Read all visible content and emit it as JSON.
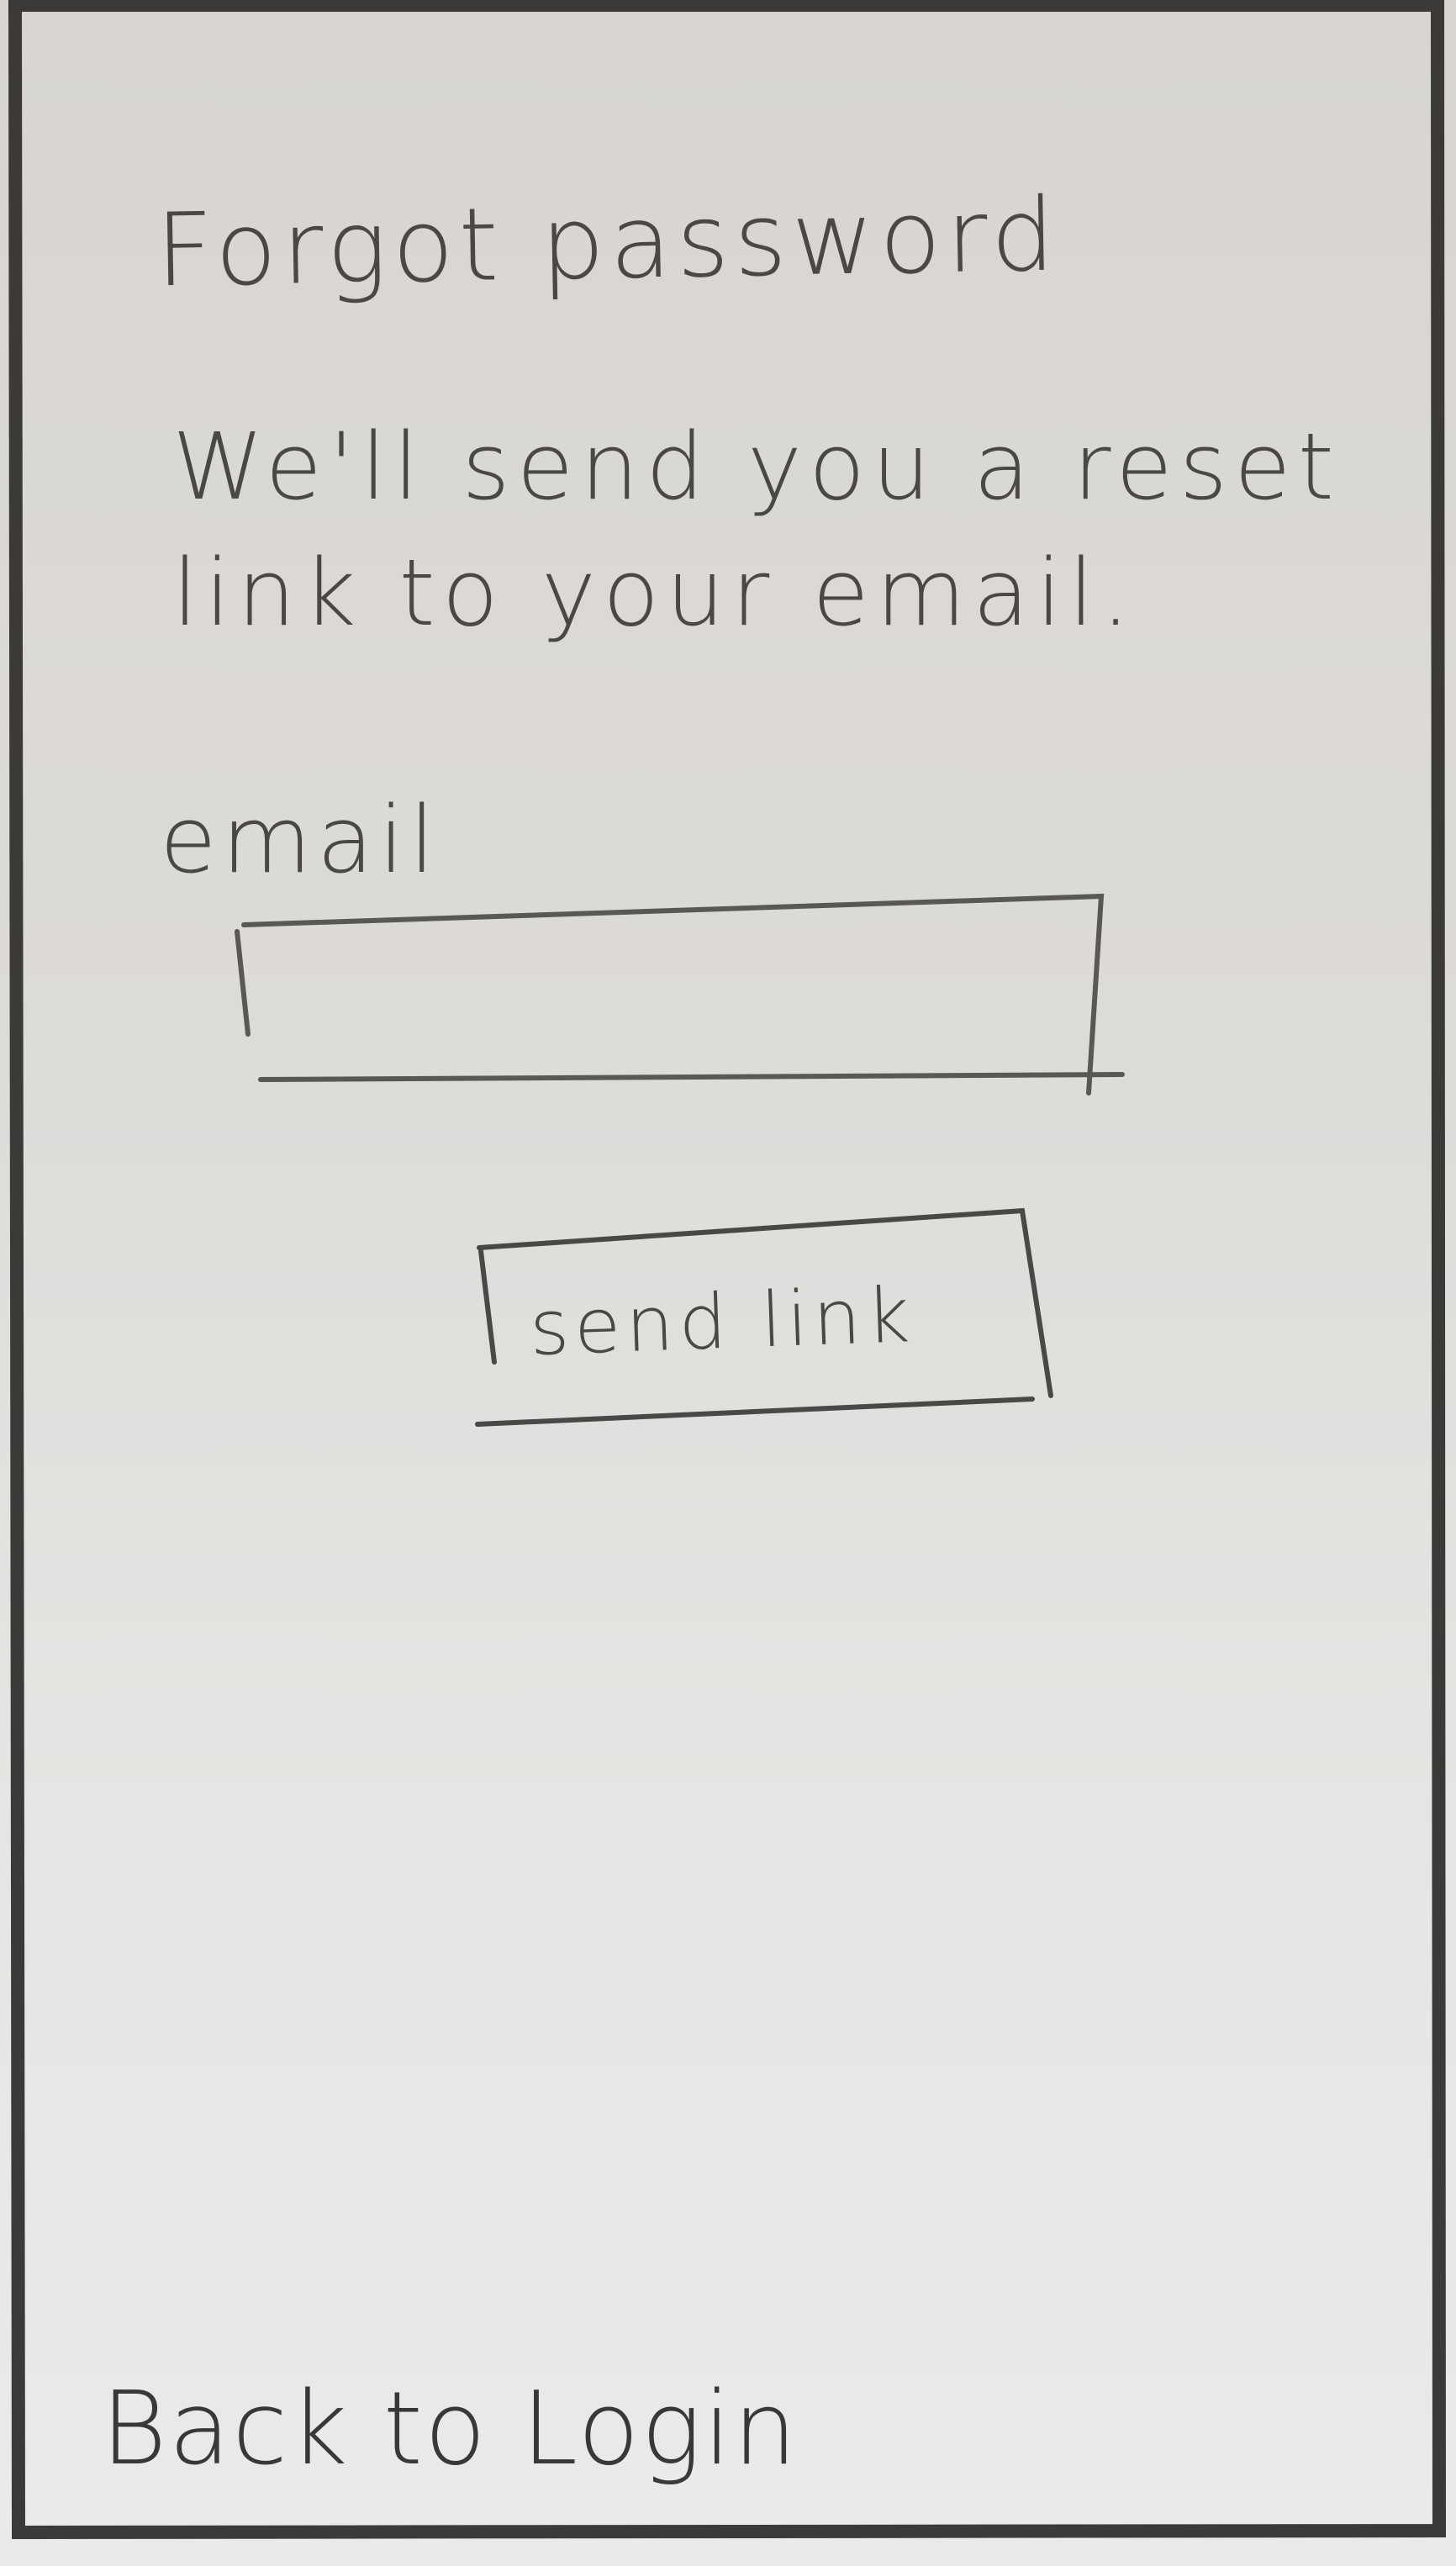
{
  "screen": {
    "title": "Forgot password",
    "subtitle": "We'll send you a reset link to your email."
  },
  "form": {
    "email_label": "email",
    "email_value": "",
    "send_button_label": "send link"
  },
  "footer": {
    "back_link_label": "Back to Login"
  }
}
